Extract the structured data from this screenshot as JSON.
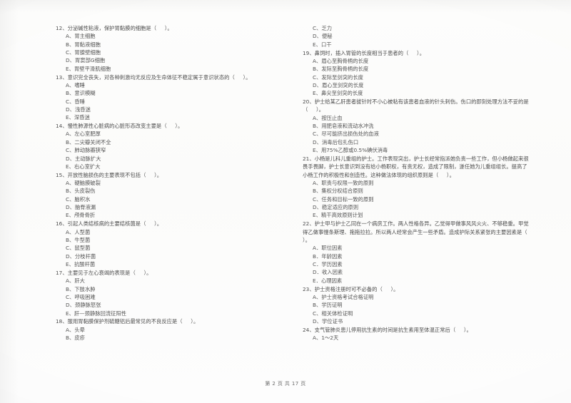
{
  "document": {
    "footer": "第 2 页 共 17 页"
  },
  "left_column": [
    {
      "number": "12",
      "stem": "12、分泌碱性粘液，保护胃黏膜的细胞是（     ）。",
      "options": [
        "A、胃主细胞",
        "B、胃黏液细胞",
        "C、胃腺壁细胞",
        "D、胃窦部G细胞",
        "E、胃壁平滑肌细胞"
      ]
    },
    {
      "number": "13",
      "stem": "13、意识完全丧失，对各种刺激均无反应及生命体征不稳定属于意识状态的（     ）。",
      "options": [
        "A、嗜睡",
        "B、意识模糊",
        "C、昏睡",
        "D、浅昏迷",
        "E、深昏迷"
      ]
    },
    {
      "number": "14",
      "stem": "14、慢性肺源性心脏病的心脏形态改变主要是（     ）。",
      "options": [
        "A、左心室肥厚",
        "B、二尖瓣关闭不全",
        "C、肺动脉瓣狭窄",
        "D、主动脉扩大",
        "E、右心室扩大"
      ]
    },
    {
      "number": "15",
      "stem": "15、开放性脑损伤的主要表现不包括（     ）。",
      "options": [
        "A、硬脑膜破裂",
        "B、头皮裂伤",
        "C、脑积水",
        "D、脑脊液漏",
        "E、颅骨骨折"
      ]
    },
    {
      "number": "16",
      "stem": "16、引起人类结核病的主要结核菌是（     ）。",
      "options": [
        "A、人型菌",
        "B、牛型菌",
        "C、鼠型菌",
        "D、分枝杆菌",
        "E、抗酸杆菌"
      ]
    },
    {
      "number": "17",
      "stem": "17、主要见于左心衰竭的表现是（     ）。",
      "options": [
        "A、肝大",
        "B、下肢水肿",
        "C、呼吸困难",
        "D、颈静脉怒张",
        "E、肝—颈静脉回流征阳性"
      ]
    },
    {
      "number": "18",
      "stem": "18、服用胃黏膜保护剂硫糖铝后最常见的不良反应是（     ）。",
      "options": [
        "A、头晕",
        "B、皮疹"
      ]
    }
  ],
  "right_column": [
    {
      "number": "18cont",
      "stem": "",
      "options": [
        "C、乏力",
        "D、便秘",
        "E、口干"
      ]
    },
    {
      "number": "19",
      "stem": "19、鼻饲时，插入胃管的长度相当于患者的（     ）。",
      "options": [
        "A、眉心至胸骨柄的长度",
        "B、发际至胸骨柄的长度",
        "C、发际至剑突的长度",
        "D、眉心至剑突的长度",
        "E、鼻尖至剑突的长度"
      ]
    },
    {
      "number": "20",
      "stem": "20、护士给某乙肝患者拔针时不小心被粘有该患者血液的针头刺伤。伤口的即刻处理方法不妥的是（     ）。",
      "options": [
        "A、按压止血",
        "B、用肥皂液和流动水冲洗",
        "C、尽可能挤出损伤处的血液",
        "D、消毒后包扎伤口",
        "E、用75%乙醇或0.5%碘伏消毒"
      ]
    },
    {
      "number": "21",
      "stem": "21、小杨是儿科儿重组的护士。工作表现突出，护士长经常指派她负责一些工作，但小杨做起来很畏手畏脚，护士长意识到没有给小杨职权，有责无权，造成了限制，遂任她为儿重组组长。提高了小杨工作的积极性和创造性。这种做法体现的组织原则是（     ）。",
      "options": [
        "A、职责与权限一致的原则",
        "B、集权分权结合原则",
        "C、任务和目标一致的原则",
        "D、稳定适应的原则",
        "E、精干高效原则计划"
      ]
    },
    {
      "number": "22",
      "stem": "22、护士甲与护士乙同在一个病房工作。两人性格各异。乙觉得甲做事风风火火、不够稳重。甲觉得乙做事慢条斯理、拖拖拉拉。所以两人经常会产生一些矛盾。造成护际关系紧张的主要因素是（     ）。",
      "options": [
        "A．职位因素",
        "B．年龄因素",
        "C．学历因素",
        "D．收入因素",
        "E．心理因素"
      ]
    },
    {
      "number": "23",
      "stem": "23、护士资格注册时可不必备的（     ）。",
      "options": [
        "A、护士资格考试合格证明",
        "B、学历证明",
        "C、相关体检证明",
        "D、学位证书"
      ]
    },
    {
      "number": "24",
      "stem": "24、支气管肺炎患儿停用抗生素的时间是抗生素用至体温正常后（     ）。",
      "options": [
        "A、1～2天"
      ]
    }
  ]
}
